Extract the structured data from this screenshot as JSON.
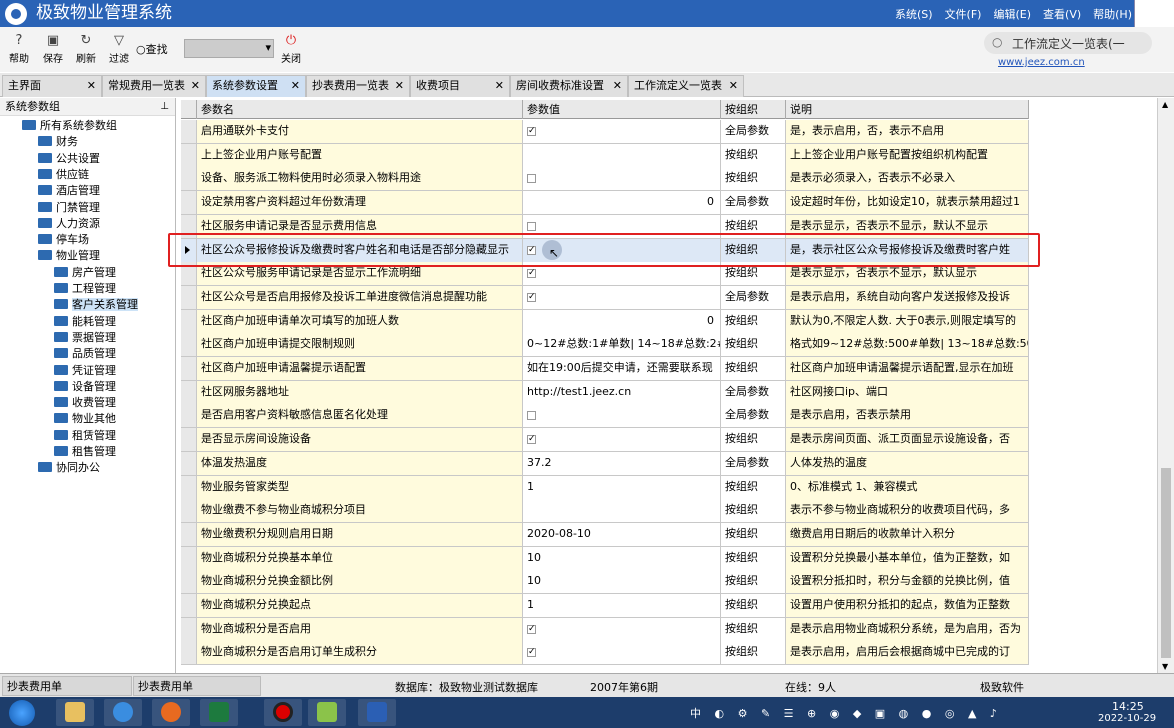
{
  "app": {
    "title": "极致物业管理系统"
  },
  "menu": [
    "系统(S)",
    "文件(F)",
    "编辑(E)",
    "查看(V)",
    "帮助(H)"
  ],
  "toolbar": {
    "buttons": [
      {
        "label": "帮助",
        "icon": "help-icon"
      },
      {
        "label": "保存",
        "icon": "save-icon"
      },
      {
        "label": "刷新",
        "icon": "refresh-icon"
      },
      {
        "label": "过滤",
        "icon": "filter-icon"
      }
    ],
    "search_label": "查找",
    "close_label": "关闭",
    "workflow_search": "工作流定义一览表(一",
    "url": "www.jeez.com.cn"
  },
  "tabs": [
    {
      "label": "主界面",
      "active": false
    },
    {
      "label": "常规费用一览表",
      "active": false
    },
    {
      "label": "系统参数设置",
      "active": true
    },
    {
      "label": "抄表费用一览表",
      "active": false
    },
    {
      "label": "收费项目",
      "active": false
    },
    {
      "label": "房间收费标准设置",
      "active": false
    },
    {
      "label": "工作流定义一览表",
      "active": false
    }
  ],
  "sidebar": {
    "title": "系统参数组",
    "root": "所有系统参数组",
    "items": [
      "财务",
      "公共设置",
      "供应链",
      "酒店管理",
      "门禁管理",
      "人力资源",
      "停车场",
      "物业管理"
    ],
    "sub_items": [
      "房产管理",
      "工程管理",
      "客户关系管理",
      "能耗管理",
      "票据管理",
      "品质管理",
      "凭证管理",
      "设备管理",
      "收费管理",
      "物业其他",
      "租赁管理",
      "租售管理"
    ],
    "selected": "客户关系管理",
    "last": "协同办公"
  },
  "grid": {
    "headers": [
      "参数名",
      "参数值",
      "按组织",
      "说明"
    ],
    "selected_row": 5,
    "rows": [
      {
        "name": "启用通联外卡支付",
        "value": "",
        "checkbox": true,
        "checked": true,
        "scope": "全局参数",
        "desc": "是，表示启用，否，表示不启用"
      },
      {
        "name": "上上签企业用户账号配置",
        "value": "",
        "checkbox": false,
        "checked": false,
        "scope": "按组织",
        "desc": "上上签企业用户账号配置按组织机构配置"
      },
      {
        "name": "设备、服务派工物料使用时必须录入物料用途",
        "value": "",
        "checkbox": true,
        "checked": false,
        "scope": "按组织",
        "desc": "是表示必须录入，否表示不必录入"
      },
      {
        "name": "设定禁用客户资料超过年份数清理",
        "value": "0",
        "checkbox": false,
        "checked": false,
        "num": true,
        "scope": "全局参数",
        "desc": "设定超时年份，比如设定10，就表示禁用超过1"
      },
      {
        "name": "社区服务申请记录是否显示费用信息",
        "value": "",
        "checkbox": true,
        "checked": false,
        "scope": "按组织",
        "desc": "是表示显示，否表示不显示，默认不显示"
      },
      {
        "name": "社区公众号报修投诉及缴费时客户姓名和电话是否部分隐藏显示",
        "value": "",
        "checkbox": true,
        "checked": true,
        "scope": "按组织",
        "desc": "是，表示社区公众号报修投诉及缴费时客户姓"
      },
      {
        "name": "社区公众号服务申请记录是否显示工作流明细",
        "value": "",
        "checkbox": true,
        "checked": true,
        "scope": "按组织",
        "desc": "是表示显示，否表示不显示，默认显示"
      },
      {
        "name": "社区公众号是否启用报修及投诉工单进度微信消息提醒功能",
        "value": "",
        "checkbox": true,
        "checked": true,
        "scope": "全局参数",
        "desc": "是表示启用，系统自动向客户发送报修及投诉"
      },
      {
        "name": "社区商户加班申请单次可填写的加班人数",
        "value": "0",
        "checkbox": false,
        "checked": false,
        "num": true,
        "scope": "按组织",
        "desc": "默认为0,不限定人数. 大于0表示,则限定填写的"
      },
      {
        "name": "社区商户加班申请提交限制规则",
        "value": "0~12#总数:1#单数| 14~18#总数:2#",
        "checkbox": false,
        "checked": false,
        "scope": "按组织",
        "desc": "格式如9~12#总数:500#单数| 13~18#总数:50"
      },
      {
        "name": "社区商户加班申请温馨提示语配置",
        "value": "如在19:00后提交申请，还需要联系现",
        "checkbox": false,
        "checked": false,
        "scope": "按组织",
        "desc": "社区商户加班申请温馨提示语配置,显示在加班"
      },
      {
        "name": "社区网服务器地址",
        "value": "http://test1.jeez.cn",
        "checkbox": false,
        "checked": false,
        "scope": "全局参数",
        "desc": "社区网接口ip、端口"
      },
      {
        "name": "是否启用客户资料敏感信息匿名化处理",
        "value": "",
        "checkbox": true,
        "checked": false,
        "scope": "全局参数",
        "desc": "是表示启用，否表示禁用"
      },
      {
        "name": "是否显示房间设施设备",
        "value": "",
        "checkbox": true,
        "checked": true,
        "scope": "按组织",
        "desc": "是表示房间页面、派工页面显示设施设备，否"
      },
      {
        "name": "体温发热温度",
        "value": "37.2",
        "checkbox": false,
        "checked": false,
        "scope": "全局参数",
        "desc": "人体发热的温度"
      },
      {
        "name": "物业服务管家类型",
        "value": "1",
        "checkbox": false,
        "checked": false,
        "scope": "按组织",
        "desc": "0、标准模式 1、兼容模式"
      },
      {
        "name": "物业缴费不参与物业商城积分项目",
        "value": "",
        "checkbox": false,
        "checked": false,
        "scope": "按组织",
        "desc": "表示不参与物业商城积分的收费项目代码，多"
      },
      {
        "name": "物业缴费积分规则启用日期",
        "value": "2020-08-10",
        "checkbox": false,
        "checked": false,
        "scope": "按组织",
        "desc": "缴费启用日期后的收款单计入积分"
      },
      {
        "name": "物业商城积分兑换基本单位",
        "value": "10",
        "checkbox": false,
        "checked": false,
        "scope": "按组织",
        "desc": "设置积分兑换最小基本单位，值为正整数，如"
      },
      {
        "name": "物业商城积分兑换金额比例",
        "value": "10",
        "checkbox": false,
        "checked": false,
        "scope": "按组织",
        "desc": "设置积分抵扣时，积分与金额的兑换比例，值"
      },
      {
        "name": "物业商城积分兑换起点",
        "value": "1",
        "checkbox": false,
        "checked": false,
        "scope": "按组织",
        "desc": "设置用户使用积分抵扣的起点，数值为正整数"
      },
      {
        "name": "物业商城积分是否启用",
        "value": "",
        "checkbox": true,
        "checked": true,
        "scope": "按组织",
        "desc": "是表示启用物业商城积分系统，是为启用，否为"
      },
      {
        "name": "物业商城积分是否启用订单生成积分",
        "value": "",
        "checkbox": true,
        "checked": true,
        "scope": "按组织",
        "desc": "是表示启用，启用后会根据商城中已完成的订"
      }
    ]
  },
  "statusbar": {
    "tabs": [
      "抄表费用单",
      "抄表费用单"
    ],
    "database": "数据库：极致物业测试数据库",
    "period": "2007年第6期",
    "online": "在线：9人",
    "vendor": "极致软件"
  },
  "taskbar": {
    "time": "14:25",
    "date": "2022-10-29",
    "ime": "中"
  },
  "colors": {
    "titlebar": "#2a63b6",
    "name_col": "#fffbdd",
    "highlight": "#e02020",
    "selected_tab": "#cfe0f3"
  }
}
